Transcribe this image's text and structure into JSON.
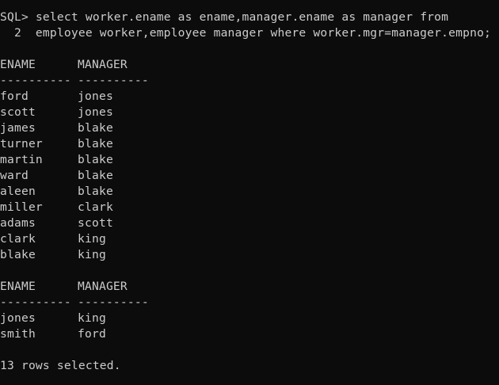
{
  "prompt": "SQL>",
  "query_line_1": " select worker.ename as ename,manager.ename as manager from",
  "query_line_2": "  2  employee worker,employee manager where worker.mgr=manager.empno;",
  "page1": {
    "headers": [
      "ENAME",
      "MANAGER"
    ],
    "separator": [
      "----------",
      "----------"
    ],
    "rows": [
      [
        "ford",
        "jones"
      ],
      [
        "scott",
        "jones"
      ],
      [
        "james",
        "blake"
      ],
      [
        "turner",
        "blake"
      ],
      [
        "martin",
        "blake"
      ],
      [
        "ward",
        "blake"
      ],
      [
        "aleen",
        "blake"
      ],
      [
        "miller",
        "clark"
      ],
      [
        "adams",
        "scott"
      ],
      [
        "clark",
        "king"
      ],
      [
        "blake",
        "king"
      ]
    ]
  },
  "page2": {
    "headers": [
      "ENAME",
      "MANAGER"
    ],
    "separator": [
      "----------",
      "----------"
    ],
    "rows": [
      [
        "jones",
        "king"
      ],
      [
        "smith",
        "ford"
      ]
    ]
  },
  "footer": "13 rows selected."
}
